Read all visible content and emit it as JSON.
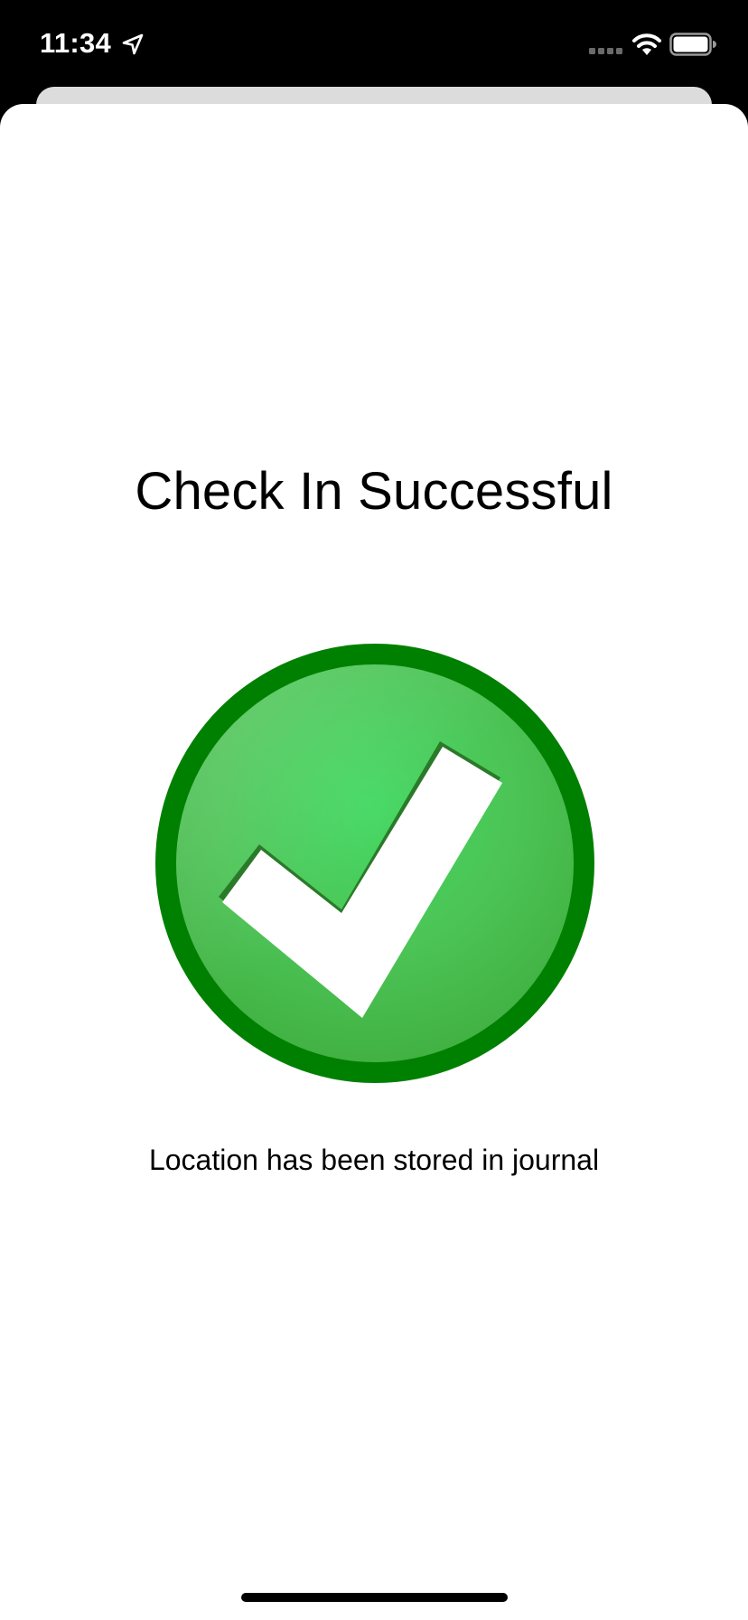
{
  "status_bar": {
    "time": "11:34",
    "icons": [
      "location-arrow-icon",
      "signal-dots-icon",
      "wifi-icon",
      "battery-icon"
    ]
  },
  "sheet": {
    "title": "Check In Successful",
    "status_icon": "checkmark-circle-icon",
    "message": "Location has been stored in journal"
  },
  "colors": {
    "ring": "#008000",
    "fill_light": "#45d964",
    "fill_dark": "#3fae3f",
    "check": "#ffffff",
    "check_shadow": "#2a7a2a"
  }
}
